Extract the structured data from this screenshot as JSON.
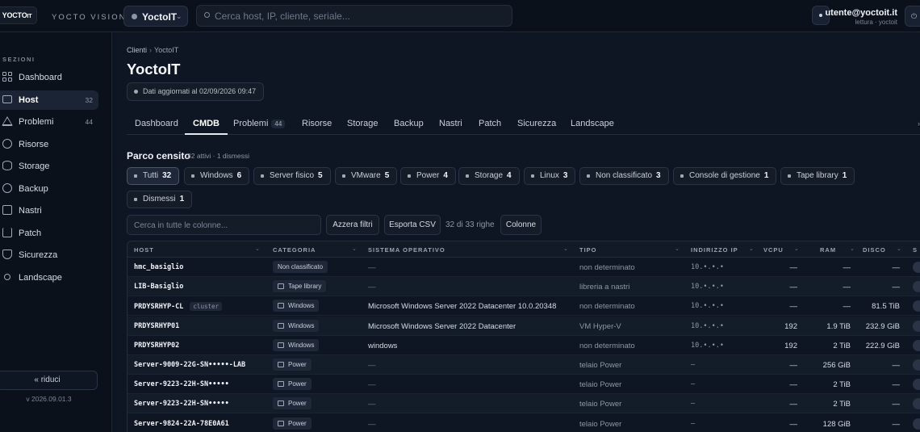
{
  "app": {
    "logo_text": "YOCTO",
    "brand": "YOCTO VISION",
    "tenant": "YoctoIT",
    "search_placeholder": "Cerca host, IP, cliente, seriale...",
    "user_email": "utente@yoctoit.it",
    "user_role": "lettura · yoctoit"
  },
  "sidebar": {
    "section_title": "SEZIONI",
    "items": [
      {
        "label": "Dashboard",
        "icon": "dashboard-grid-icon",
        "count": ""
      },
      {
        "label": "Host",
        "icon": "server-icon",
        "count": "32"
      },
      {
        "label": "Problemi",
        "icon": "warning-triangle-icon",
        "count": "44"
      },
      {
        "label": "Risorse",
        "icon": "gear-icon",
        "count": ""
      },
      {
        "label": "Storage",
        "icon": "database-icon",
        "count": ""
      },
      {
        "label": "Backup",
        "icon": "backup-icon",
        "count": ""
      },
      {
        "label": "Nastri",
        "icon": "tape-icon",
        "count": ""
      },
      {
        "label": "Patch",
        "icon": "download-icon",
        "count": ""
      },
      {
        "label": "Sicurezza",
        "icon": "shield-icon",
        "count": ""
      },
      {
        "label": "Landscape",
        "icon": "network-icon",
        "count": ""
      }
    ],
    "collapse_label": "« riduci",
    "version": "v 2026.09.01.3"
  },
  "main": {
    "breadcrumb_root": "Clienti",
    "breadcrumb_sep": "›",
    "breadcrumb_current": "YoctoIT",
    "title": "YoctoIT",
    "updated": "Dati aggiornati al 02/09/2026 09:47",
    "tabs": [
      {
        "label": "Dashboard",
        "badge": ""
      },
      {
        "label": "CMDB",
        "badge": ""
      },
      {
        "label": "Problemi",
        "badge": "44"
      },
      {
        "label": "Risorse",
        "badge": ""
      },
      {
        "label": "Storage",
        "badge": ""
      },
      {
        "label": "Backup",
        "badge": ""
      },
      {
        "label": "Nastri",
        "badge": ""
      },
      {
        "label": "Patch",
        "badge": ""
      },
      {
        "label": "Sicurezza",
        "badge": ""
      },
      {
        "label": "Landscape",
        "badge": ""
      }
    ],
    "tabs_more": "›",
    "census_title": "Parco censito",
    "census_sub": "32 attivi · 1 dismessi",
    "chips": [
      {
        "label": "Tutti",
        "count": "32"
      },
      {
        "label": "Windows",
        "count": "6"
      },
      {
        "label": "Server fisico",
        "count": "5"
      },
      {
        "label": "VMware",
        "count": "5"
      },
      {
        "label": "Power",
        "count": "4"
      },
      {
        "label": "Storage",
        "count": "4"
      },
      {
        "label": "Linux",
        "count": "3"
      },
      {
        "label": "Non classificato",
        "count": "3"
      },
      {
        "label": "Console di gestione",
        "count": "1"
      },
      {
        "label": "Tape library",
        "count": "1"
      },
      {
        "label": "Dismessi",
        "count": "1"
      }
    ],
    "filter_placeholder": "Cerca in tutte le colonne...",
    "btn_reset": "Azzera filtri",
    "btn_export": "Esporta CSV",
    "row_count": "32 di 33 righe",
    "btn_columns": "Colonne"
  },
  "table": {
    "headers": [
      "HOST",
      "CATEGORIA",
      "SISTEMA OPERATIVO",
      "TIPO",
      "INDIRIZZO IP",
      "VCPU",
      "RAM",
      "DISCO",
      "S"
    ],
    "rows": [
      {
        "host": "hmc_basiglio",
        "tag": "",
        "cat": "Non classificato",
        "os": "—",
        "tipo": "non determinato",
        "ip": "10.•.•.•",
        "vcpu": "—",
        "ram": "—",
        "disco": "—"
      },
      {
        "host": "LIB-Basiglio",
        "tag": "",
        "cat": "Tape library",
        "os": "—",
        "tipo": "libreria a nastri",
        "ip": "10.•.•.•",
        "vcpu": "—",
        "ram": "—",
        "disco": "—"
      },
      {
        "host": "PRDYSRHYP-CL",
        "tag": "cluster",
        "cat": "Windows",
        "os": "Microsoft Windows Server 2022 Datacenter 10.0.20348",
        "tipo": "non determinato",
        "ip": "10.•.•.•",
        "vcpu": "—",
        "ram": "—",
        "disco": "81.5 TiB"
      },
      {
        "host": "PRDYSRHYP01",
        "tag": "",
        "cat": "Windows",
        "os": "Microsoft Windows Server 2022 Datacenter",
        "tipo": "VM Hyper-V",
        "ip": "10.•.•.•",
        "vcpu": "192",
        "ram": "1.9 TiB",
        "disco": "232.9 GiB"
      },
      {
        "host": "PRDYSRHYP02",
        "tag": "",
        "cat": "Windows",
        "os": "windows",
        "tipo": "non determinato",
        "ip": "10.•.•.•",
        "vcpu": "192",
        "ram": "2 TiB",
        "disco": "222.9 GiB"
      },
      {
        "host": "Server-9009-22G-SN•••••-LAB",
        "tag": "",
        "cat": "Power",
        "os": "—",
        "tipo": "telaio Power",
        "ip": "—",
        "vcpu": "—",
        "ram": "256 GiB",
        "disco": "—"
      },
      {
        "host": "Server-9223-22H-SN•••••",
        "tag": "",
        "cat": "Power",
        "os": "—",
        "tipo": "telaio Power",
        "ip": "—",
        "vcpu": "—",
        "ram": "2 TiB",
        "disco": "—"
      },
      {
        "host": "Server-9223-22H-SN•••••",
        "tag": "",
        "cat": "Power",
        "os": "—",
        "tipo": "telaio Power",
        "ip": "—",
        "vcpu": "—",
        "ram": "2 TiB",
        "disco": "—"
      },
      {
        "host": "Server-9824-22A-78E0A61",
        "tag": "",
        "cat": "Power",
        "os": "—",
        "tipo": "telaio Power",
        "ip": "—",
        "vcpu": "—",
        "ram": "128 GiB",
        "disco": "—"
      }
    ]
  }
}
